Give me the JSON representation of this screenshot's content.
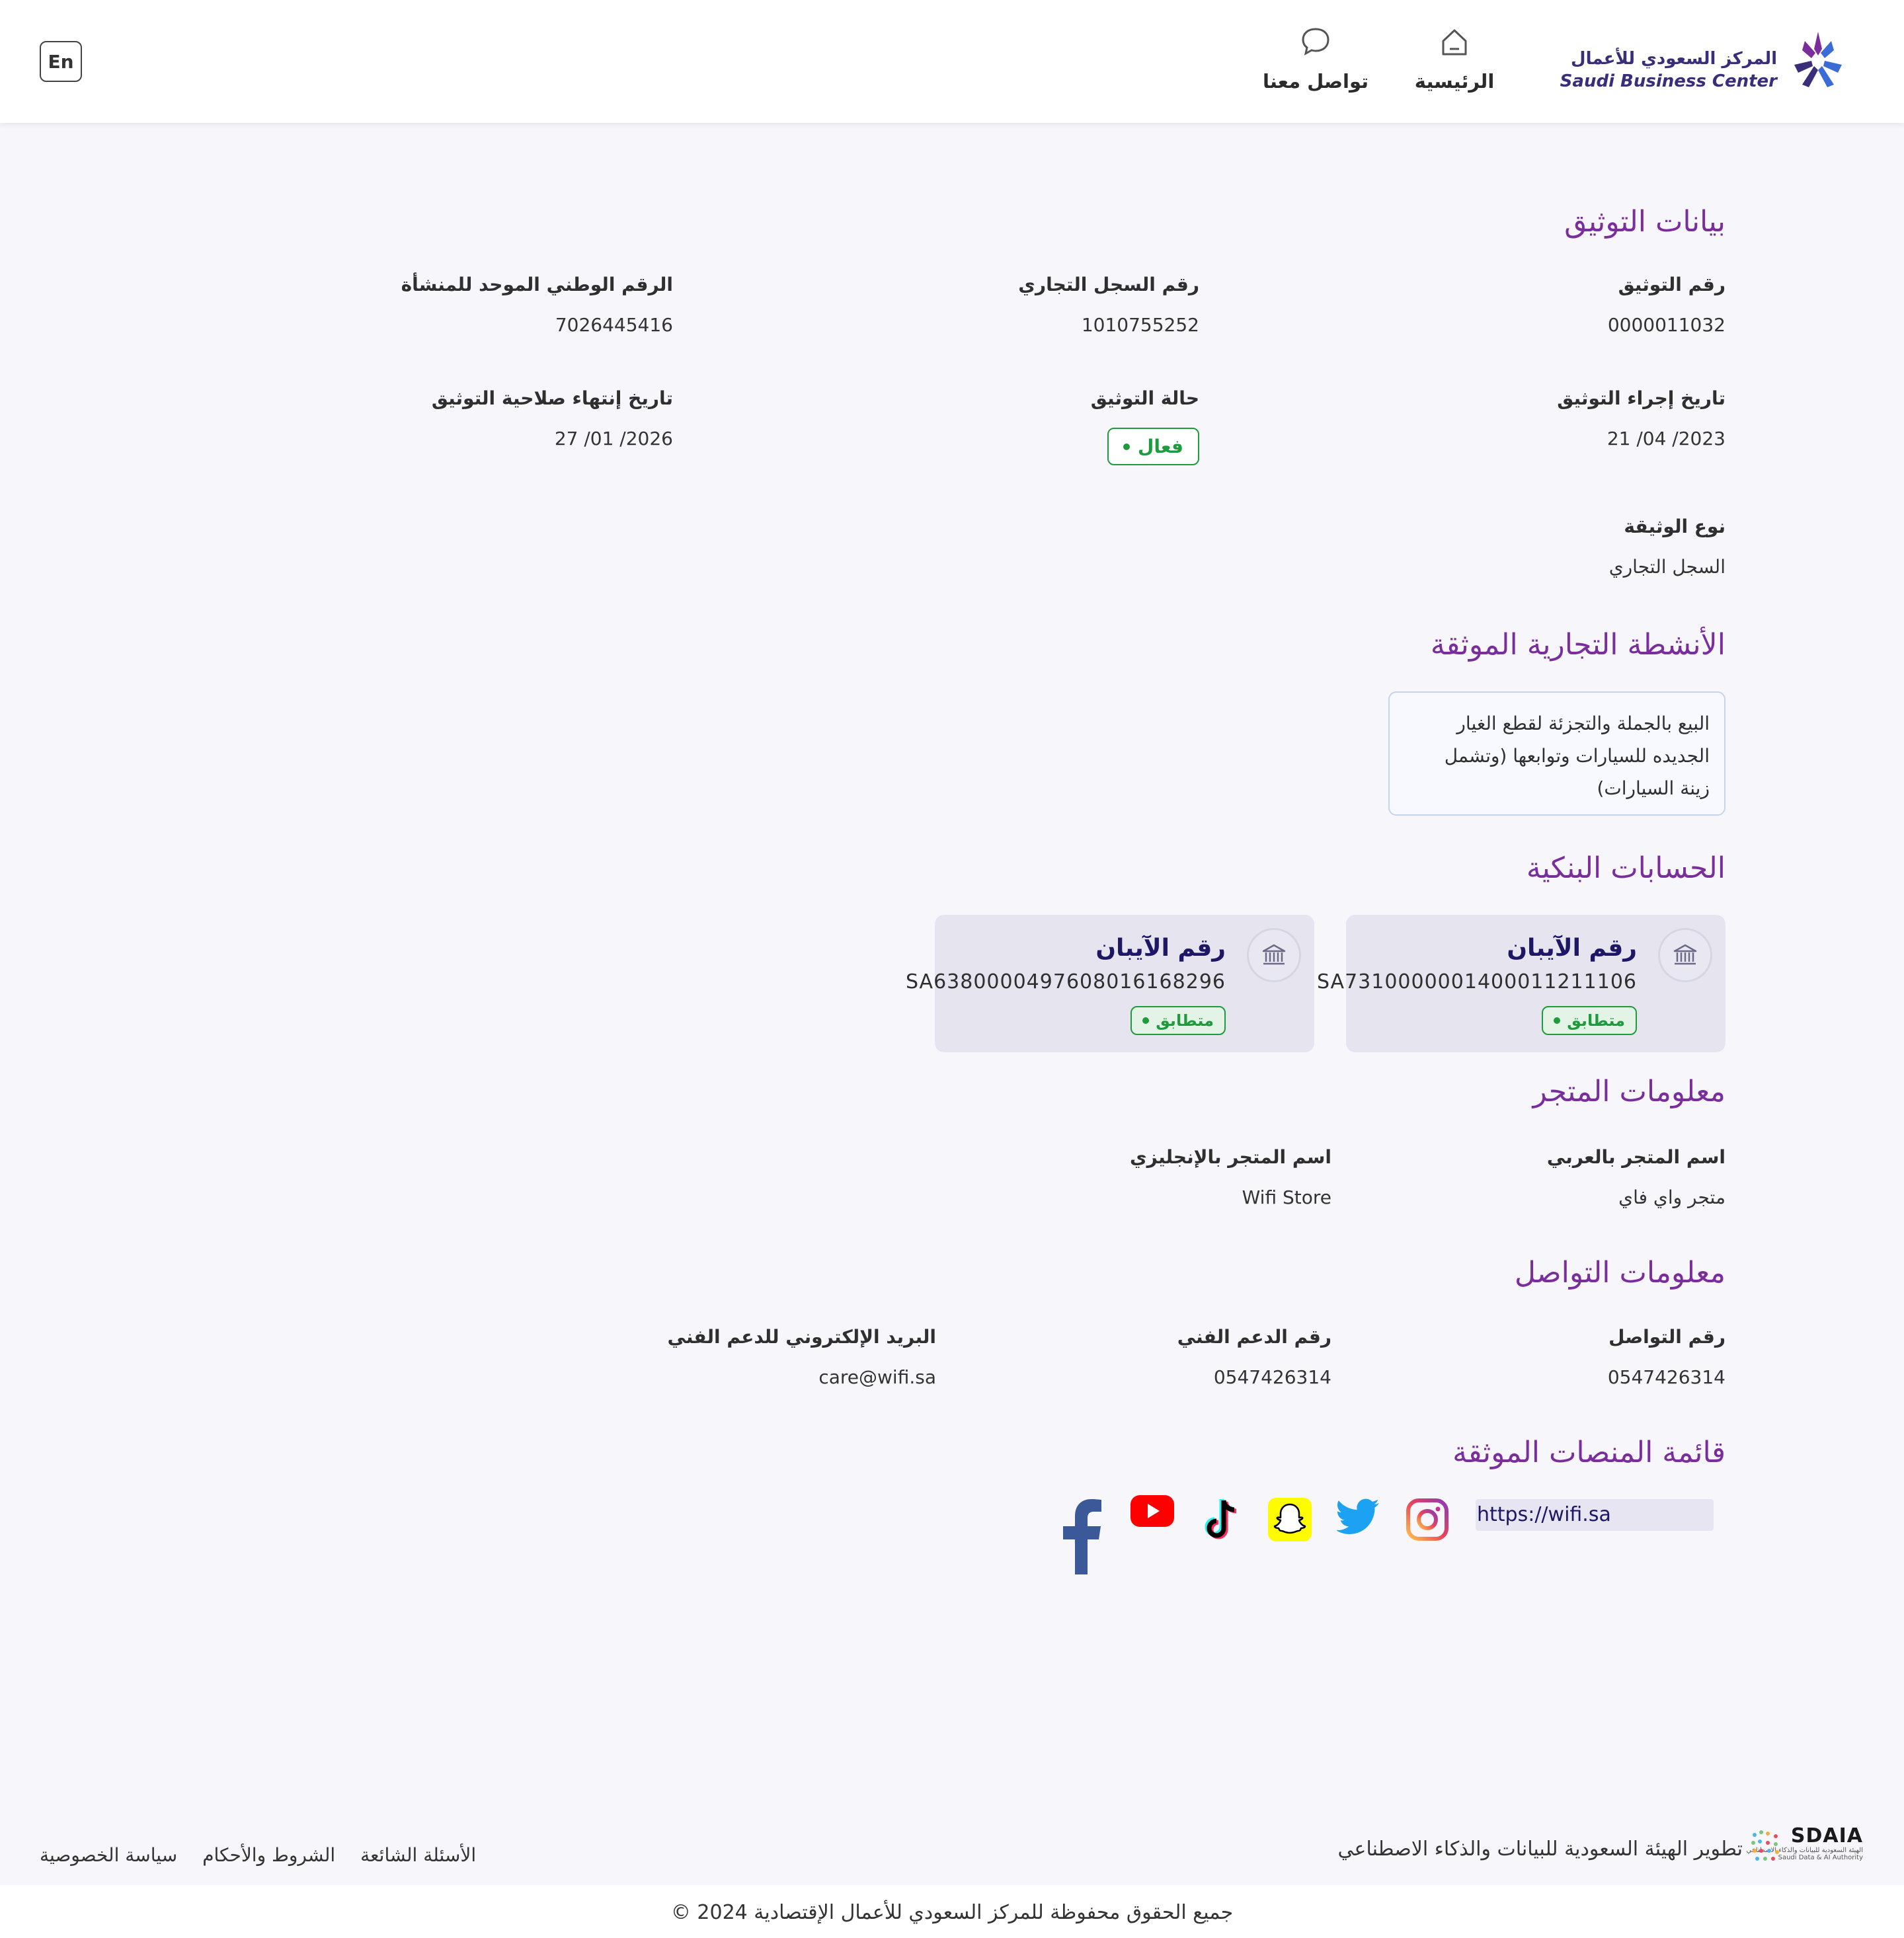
{
  "header": {
    "lang_label": "En",
    "nav_home": "الرئيسية",
    "nav_contact": "تواصل معنا",
    "logo_ar": "المركز السعودي للأعمال",
    "logo_en": "Saudi Business Center"
  },
  "auth": {
    "title": "بيانات التوثيق",
    "doc_number_label": "رقم التوثيق",
    "doc_number_value": "0000011032",
    "cr_label": "رقم السجل التجاري",
    "cr_value": "1010755252",
    "unified_label": "الرقم الوطني الموحد للمنشأة",
    "unified_value": "7026445416",
    "auth_date_label": "تاريخ إجراء التوثيق",
    "auth_date_value": "21 /04 /2023",
    "status_label": "حالة التوثيق",
    "status_value": "فعال",
    "expiry_label": "تاريخ إنتهاء صلاحية التوثيق",
    "expiry_value": "27 /01 /2026",
    "doc_type_label": "نوع الوثيقة",
    "doc_type_value": "السجل التجاري"
  },
  "activities": {
    "title": "الأنشطة التجارية الموثقة",
    "lines": [
      "البيع بالجملة والتجزئة لقطع الغيار",
      "الجديده للسيارات وتوابعها (وتشمل",
      "زينة السيارات)"
    ]
  },
  "bank": {
    "title": "الحسابات البنكية",
    "accounts": [
      {
        "label": "رقم الآيبان",
        "iban": "SA7310000001400011211106",
        "status": "متطابق"
      },
      {
        "label": "رقم الآيبان",
        "iban": "SA6380000497608016168296",
        "status": "متطابق"
      }
    ]
  },
  "store": {
    "title": "معلومات المتجر",
    "name_ar_label": "اسم المتجر بالعربي",
    "name_ar_value": "متجر واي فاي",
    "name_en_label": "اسم المتجر بالإنجليزي",
    "name_en_value": "Wifi Store"
  },
  "contact": {
    "title": "معلومات التواصل",
    "phone_label": "رقم التواصل",
    "phone_value": "0547426314",
    "support_label": "رقم الدعم الفني",
    "support_value": "0547426314",
    "email_label": "البريد الإلكتروني للدعم الفني",
    "email_value": "care@wifi.sa"
  },
  "platforms": {
    "title": "قائمة المنصات الموثقة",
    "url": "https://wifi.sa",
    "icons": [
      "instagram-icon",
      "twitter-icon",
      "snapchat-icon",
      "tiktok-icon",
      "youtube-icon",
      "facebook-icon"
    ]
  },
  "footer": {
    "sdaia_text": "تطوير الهيئة السعودية للبيانات والذكاء الاصطناعي",
    "sdaia_name": "SDAIA",
    "sdaia_sub_ar": "الهيئة السعودية للبيانات والذكاء الاصطناعي",
    "sdaia_sub_en": "Saudi Data & AI Authority",
    "privacy": "سياسة الخصوصية",
    "terms": "الشروط والأحكام",
    "faq": "الأسئلة الشائعة",
    "copyright": "جميع الحقوق محفوظة للمركز السعودي للأعمال الإقتصادية 2024 ©"
  },
  "colors": {
    "accent_purple": "#7a2e9b",
    "navy": "#1d1766",
    "success_green": "#1e9b3c",
    "page_bg": "#f7f6fb"
  }
}
